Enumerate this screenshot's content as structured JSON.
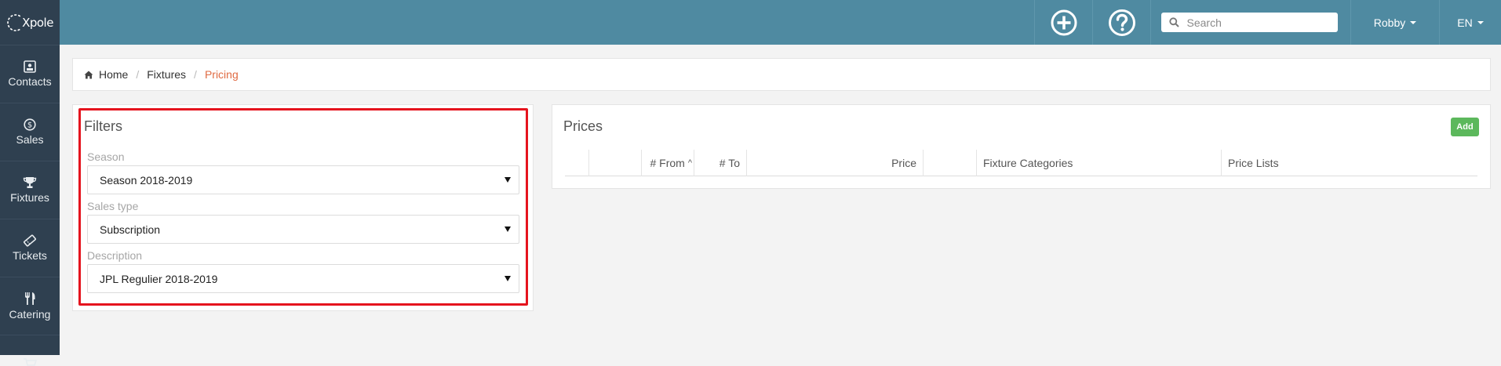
{
  "app": {
    "logo_text": "Xpole"
  },
  "sidebar": {
    "items": [
      {
        "label": "Contacts",
        "icon": "contact-card-icon"
      },
      {
        "label": "Sales",
        "icon": "dollar-circle-icon"
      },
      {
        "label": "Fixtures",
        "icon": "trophy-icon"
      },
      {
        "label": "Tickets",
        "icon": "ticket-icon"
      },
      {
        "label": "Catering",
        "icon": "fork-knife-icon"
      }
    ]
  },
  "topbar": {
    "search": {
      "placeholder": "Search"
    },
    "user": {
      "label": "Robby"
    },
    "language": {
      "label": "EN"
    }
  },
  "breadcrumb": {
    "items": [
      "Home",
      "Fixtures",
      "Pricing"
    ]
  },
  "filters": {
    "title": "Filters",
    "fields": [
      {
        "label": "Season",
        "value": "Season 2018-2019"
      },
      {
        "label": "Sales type",
        "value": "Subscription"
      },
      {
        "label": "Description",
        "value": "JPL Regulier 2018-2019"
      }
    ]
  },
  "prices": {
    "title": "Prices",
    "add_label": "Add",
    "columns": [
      "# From",
      "# To",
      "Price",
      "Fixture Categories",
      "Price Lists"
    ]
  },
  "colors": {
    "sidebar": "#2f4050",
    "topbar": "#4f8aa1",
    "accent": "#e06b43",
    "add_button": "#5cb85c",
    "highlight": "#e5141e"
  }
}
